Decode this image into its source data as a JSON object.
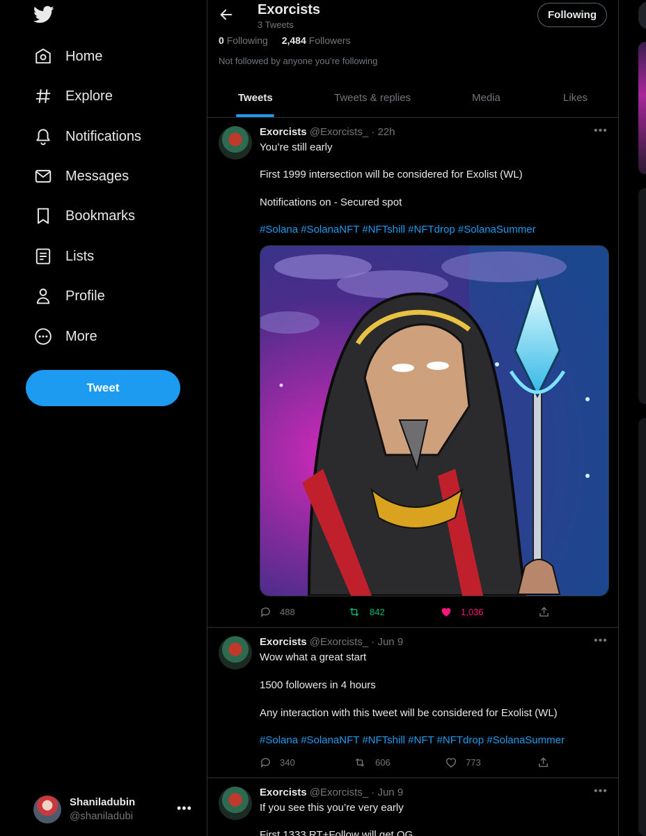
{
  "sidebar": {
    "items": [
      {
        "label": "Home",
        "icon": "home-icon"
      },
      {
        "label": "Explore",
        "icon": "hashtag-icon"
      },
      {
        "label": "Notifications",
        "icon": "bell-icon"
      },
      {
        "label": "Messages",
        "icon": "envelope-icon"
      },
      {
        "label": "Bookmarks",
        "icon": "bookmark-icon"
      },
      {
        "label": "Lists",
        "icon": "list-icon"
      },
      {
        "label": "Profile",
        "icon": "person-icon"
      },
      {
        "label": "More",
        "icon": "more-circle-icon"
      }
    ],
    "tweet_button": "Tweet",
    "account": {
      "name": "Shaniladubin",
      "handle": "@shaniladubi",
      "more": "•••"
    }
  },
  "header": {
    "title": "Exorcists",
    "subtitle": "3 Tweets",
    "follow_button": "Following",
    "following_count": "0",
    "following_label": "Following",
    "followers_count": "2,484",
    "followers_label": "Followers",
    "not_followed": "Not followed by anyone you’re following"
  },
  "tabs": [
    "Tweets",
    "Tweets & replies",
    "Media",
    "Likes"
  ],
  "tweets": [
    {
      "name": "Exorcists",
      "meta": "@Exorcists_ · 22h",
      "lines": [
        "You’re still early",
        "First 1999 intersection will be considered for Exolist (WL)",
        "Notifications on - Secured spot"
      ],
      "tags": "#Solana #SolanaNFT #NFTshill #NFTdrop #SolanaSummer",
      "replies": "488",
      "retweets": "842",
      "likes": "1,036"
    },
    {
      "name": "Exorcists",
      "meta": "@Exorcists_ · Jun 9",
      "lines": [
        "Wow what a great start",
        "1500 followers in 4 hours",
        "Any interaction with this tweet will be considered for Exolist (WL)"
      ],
      "tags": "#Solana #SolanaNFT #NFTshill #NFT #NFTdrop #SolanaSummer",
      "replies": "340",
      "retweets": "606",
      "likes": "773"
    },
    {
      "name": "Exorcists",
      "meta": "@Exorcists_ · Jun 9",
      "lines": [
        "If you see this you’re very early",
        "First 1333 RT+Follow will get OG"
      ]
    }
  ],
  "colors": {
    "accent": "#1d9bf0",
    "retweet": "#00ba7c",
    "like": "#f91880",
    "muted": "#71767b"
  }
}
